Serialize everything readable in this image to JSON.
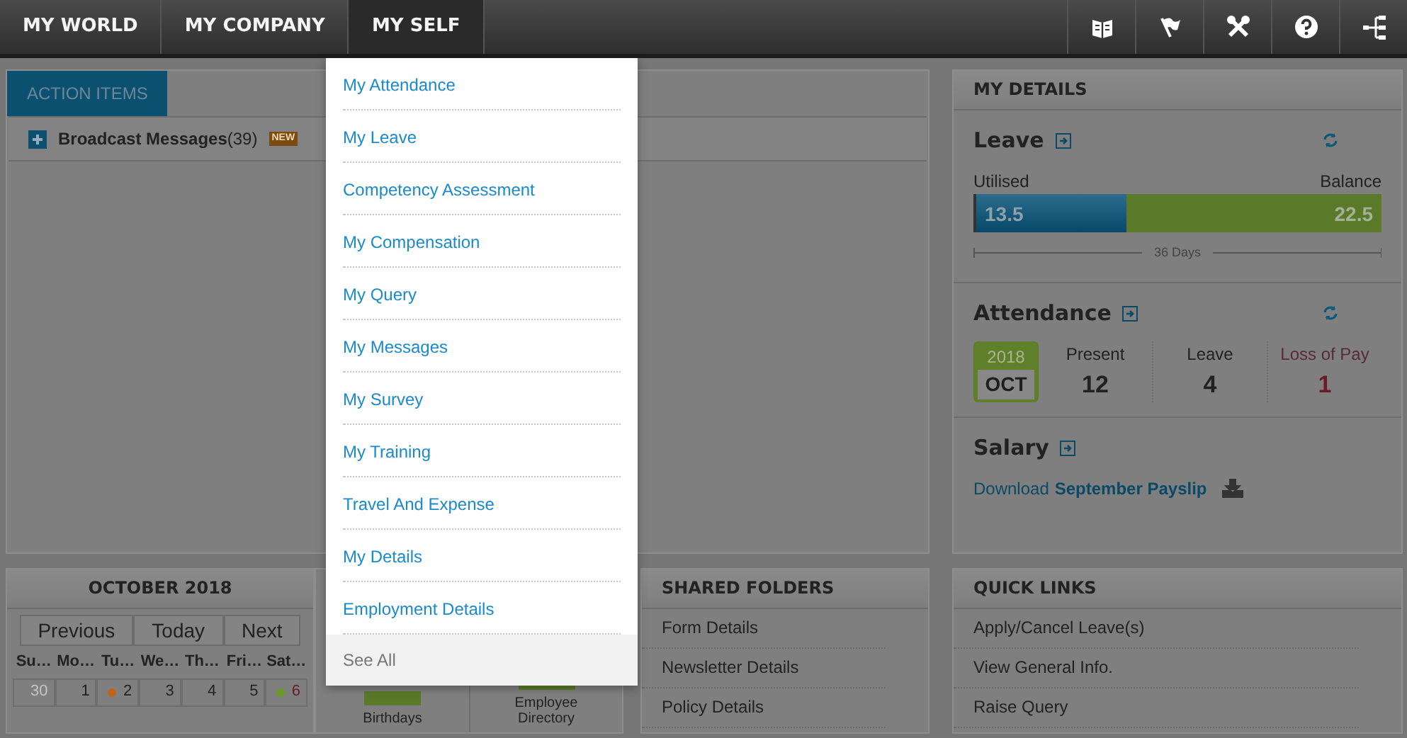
{
  "nav": {
    "tabs": [
      {
        "label": "MY WORLD",
        "selected": false
      },
      {
        "label": "MY COMPANY",
        "selected": false
      },
      {
        "label": "MY SELF",
        "selected": true
      }
    ]
  },
  "menu": {
    "items": [
      {
        "label": "My Attendance",
        "kind": "link"
      },
      {
        "label": "My Leave",
        "kind": "link"
      },
      {
        "label": "Competency Assessment",
        "kind": "link"
      },
      {
        "label": "My Compensation",
        "kind": "link"
      },
      {
        "label": "My Query",
        "kind": "link"
      },
      {
        "label": "My Messages",
        "kind": "link"
      },
      {
        "label": "My Survey",
        "kind": "link"
      },
      {
        "label": "My Training",
        "kind": "link"
      },
      {
        "label": "Travel And Expense",
        "kind": "link"
      },
      {
        "label": "My Details",
        "kind": "link"
      },
      {
        "label": "Employment Details",
        "kind": "link"
      },
      {
        "label": "See All",
        "kind": "footer"
      }
    ]
  },
  "action_items": {
    "tab": "ACTION ITEMS",
    "rows": [
      {
        "label": "Broadcast Messages",
        "count": "(39)",
        "badge": "NEW",
        "expanded": false
      }
    ]
  },
  "my_details": {
    "title": "MY DETAILS",
    "leave": {
      "title": "Leave",
      "utilised_label": "Utilised",
      "balance_label": "Balance",
      "utilised": "13.5",
      "balance": "22.5",
      "level": 0.375,
      "total": "36 Days"
    },
    "attendance": {
      "title": "Attendance",
      "year": "2018",
      "month": "OCT",
      "stats": [
        {
          "label": "Present",
          "value": "12",
          "kind": "normal"
        },
        {
          "label": "Leave",
          "value": "4",
          "kind": "normal"
        },
        {
          "label": "Loss of Pay",
          "value": "1",
          "kind": "alert"
        }
      ]
    },
    "salary": {
      "title": "Salary",
      "prefix": "Download",
      "link": "September Payslip"
    }
  },
  "calendar": {
    "title": "OCTOBER 2018",
    "buttons": [
      "Previous",
      "Today",
      "Next"
    ],
    "weekdays": [
      "Su…",
      "Mo…",
      "Tu…",
      "We…",
      "Th…",
      "Fri…",
      "Sat…"
    ],
    "days": [
      {
        "label": "30",
        "other_month": true,
        "weekend": false
      },
      {
        "label": "1",
        "other_month": false,
        "weekend": false
      },
      {
        "label": "2",
        "other_month": false,
        "weekend": false,
        "color": "#c0641a"
      },
      {
        "label": "3",
        "other_month": false,
        "weekend": false
      },
      {
        "label": "4",
        "other_month": false,
        "weekend": false
      },
      {
        "label": "5",
        "other_month": false,
        "weekend": false
      },
      {
        "label": "6",
        "other_month": false,
        "weekend": true,
        "color": "#6a9a2a"
      }
    ]
  },
  "widgets": [
    {
      "label": "Birthdays"
    },
    {
      "label": "Employee Directory"
    }
  ],
  "shared_folders": {
    "title": "SHARED FOLDERS",
    "items": [
      "Form Details",
      "Newsletter Details",
      "Policy Details"
    ]
  },
  "quick_links": {
    "title": "QUICK LINKS",
    "items": [
      "Apply/Cancel Leave(s)",
      "View General Info.",
      "Raise Query"
    ]
  }
}
